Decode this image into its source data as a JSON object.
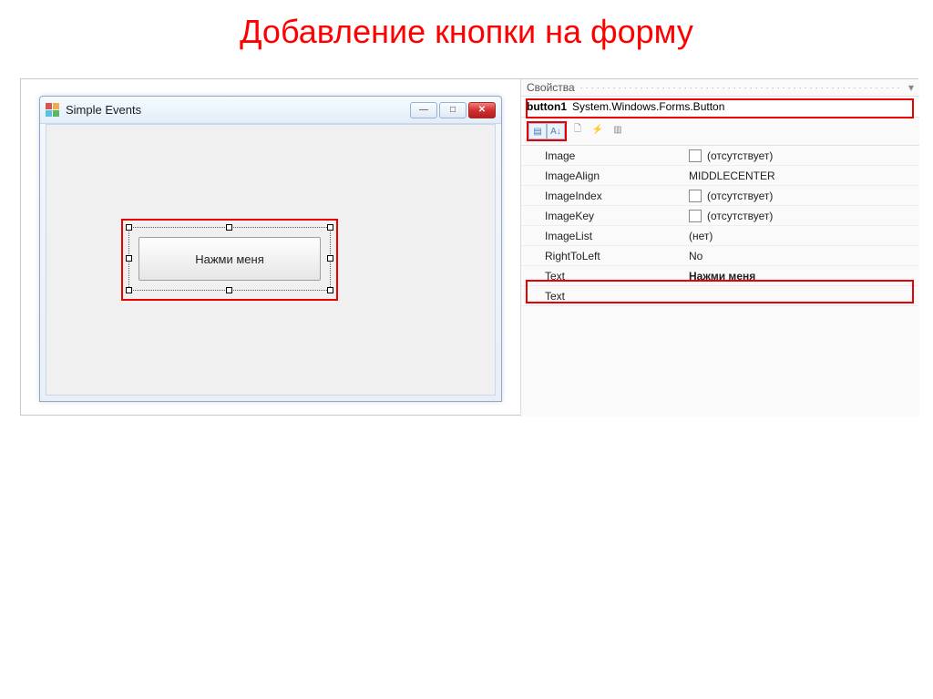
{
  "heading": "Добавление кнопки на форму",
  "form": {
    "title": "Simple Events",
    "button_text": "Нажми меня"
  },
  "properties": {
    "panel_title": "Свойства",
    "selected_object_name": "button1",
    "selected_object_type": "System.Windows.Forms.Button",
    "rows": [
      {
        "name": "Image",
        "value": "(отсутствует)",
        "swatch": true
      },
      {
        "name": "ImageAlign",
        "value": "MIDDLECENTER",
        "swatch": false
      },
      {
        "name": "ImageIndex",
        "value": "(отсутствует)",
        "swatch": true
      },
      {
        "name": "ImageKey",
        "value": "(отсутствует)",
        "swatch": true
      },
      {
        "name": "ImageList",
        "value": "(нет)",
        "swatch": false
      },
      {
        "name": "RightToLeft",
        "value": "No",
        "swatch": false
      },
      {
        "name": "Text",
        "value": "Нажми меня",
        "swatch": false,
        "bold": true
      },
      {
        "name": "Text",
        "value": "",
        "swatch": false
      }
    ]
  }
}
